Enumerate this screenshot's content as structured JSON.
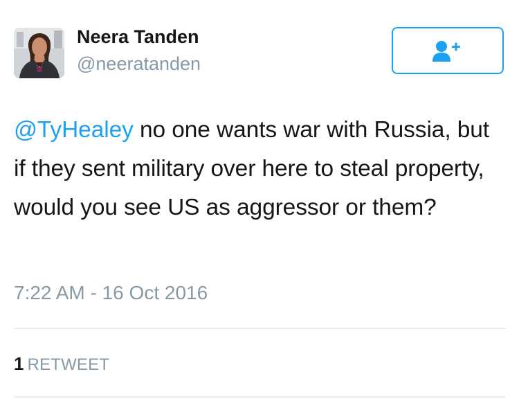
{
  "author": {
    "display_name": "Neera Tanden",
    "handle": "@neeratanden",
    "avatar_icon": "profile-photo"
  },
  "follow_button": {
    "icon": "follow-user-icon",
    "color": "#1da1f2"
  },
  "tweet": {
    "mention": "@TyHealey",
    "text": " no one wants war with Russia, but if they sent military over here to steal property, would you see US as aggressor or them?",
    "timestamp": "7:22 AM - 16 Oct 2016"
  },
  "stats": {
    "retweet_count": "1",
    "retweet_label": "RETWEET"
  },
  "colors": {
    "link": "#1da1f2",
    "secondary_text": "#8899a6",
    "primary_text": "#14171a",
    "divider": "#e6ecf0"
  }
}
